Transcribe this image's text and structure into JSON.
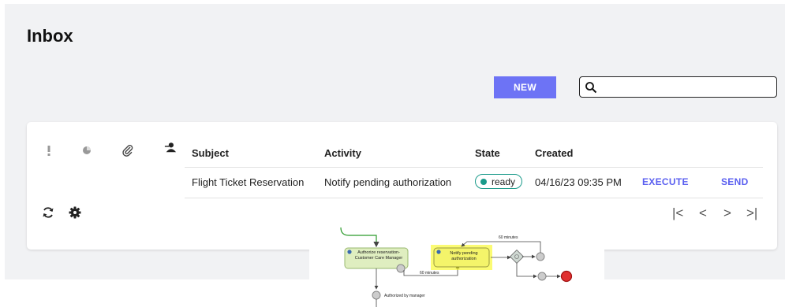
{
  "page": {
    "title": "Inbox"
  },
  "toolbar": {
    "new_label": "NEW"
  },
  "search": {
    "value": "",
    "placeholder": ""
  },
  "table": {
    "columns": [
      "Subject",
      "Activity",
      "State",
      "Created"
    ],
    "header_icons": [
      "priority-icon",
      "status-icon",
      "attachment-icon",
      "assignee-icon"
    ],
    "rows": [
      {
        "subject": "Flight Ticket Reservation",
        "activity": "Notify pending authorization",
        "state": "ready",
        "created": "04/16/23 09:35 PM",
        "actions": [
          "EXECUTE",
          "SEND"
        ]
      }
    ]
  },
  "footer": {
    "left_icons": [
      "refresh-icon",
      "settings-icon"
    ],
    "pager_icons": [
      "first-page-icon",
      "prev-page-icon",
      "next-page-icon",
      "last-page-icon"
    ]
  },
  "diagram": {
    "task1": "Authorize reservation- Customer Care Manager",
    "task2": "Notify pending authorization",
    "timer_top": "60 minutes",
    "timer_bottom": "60 minutes",
    "event_label": "Authorized by manager"
  },
  "colors": {
    "accent": "#6d73f5",
    "link": "#5a5ff0",
    "state_ready": "#1a9a8a",
    "highlight": "#f7f700"
  }
}
